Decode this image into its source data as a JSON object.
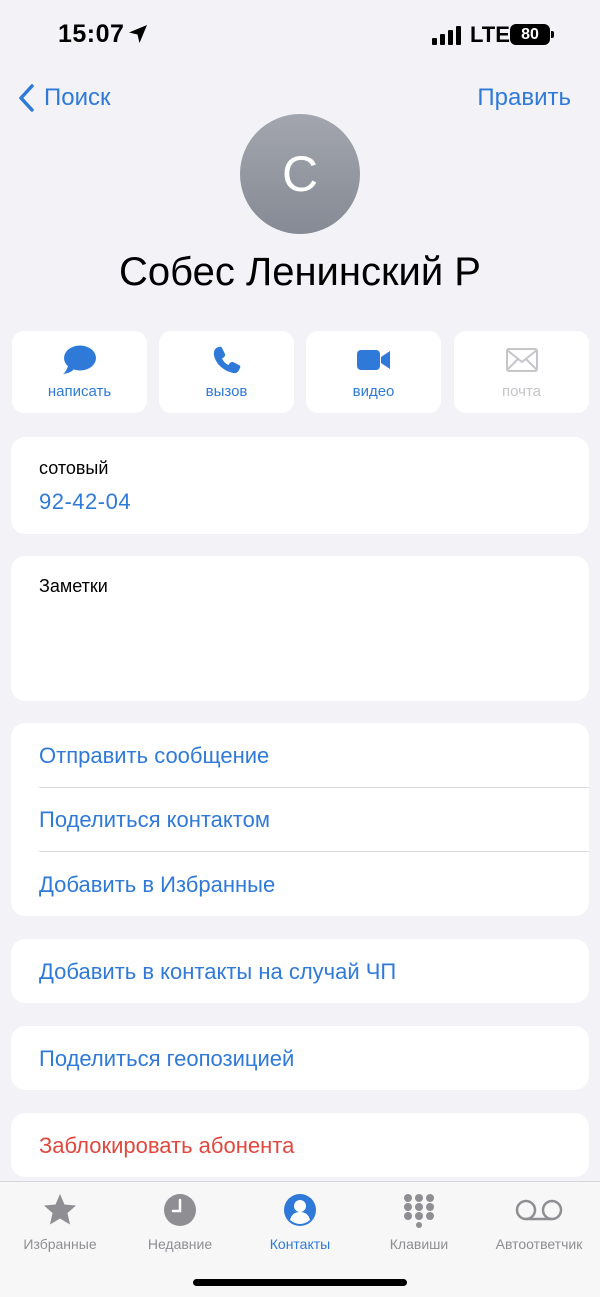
{
  "status": {
    "time": "15:07",
    "network": "LTE",
    "battery": "80"
  },
  "nav": {
    "back_label": "Поиск",
    "edit_label": "Править"
  },
  "contact": {
    "initial": "С",
    "name": "Собес Ленинский Р"
  },
  "actions": [
    {
      "label": "написать",
      "icon": "message-icon",
      "enabled": true
    },
    {
      "label": "вызов",
      "icon": "phone-icon",
      "enabled": true
    },
    {
      "label": "видео",
      "icon": "video-icon",
      "enabled": true
    },
    {
      "label": "почта",
      "icon": "mail-icon",
      "enabled": false
    }
  ],
  "phone": {
    "label": "сотовый",
    "value": "92-42-04"
  },
  "notes": {
    "label": "Заметки"
  },
  "links": {
    "send_message": "Отправить сообщение",
    "share_contact": "Поделиться контактом",
    "add_favorites": "Добавить в Избранные",
    "add_emergency": "Добавить в контакты на случай ЧП",
    "share_location": "Поделиться геопозицией",
    "block_caller": "Заблокировать абонента"
  },
  "tabs": [
    {
      "label": "Избранные",
      "icon": "star-icon",
      "active": false
    },
    {
      "label": "Недавние",
      "icon": "clock-icon",
      "active": false
    },
    {
      "label": "Контакты",
      "icon": "contact-icon",
      "active": true
    },
    {
      "label": "Клавиши",
      "icon": "keypad-icon",
      "active": false
    },
    {
      "label": "Автоответчик",
      "icon": "voicemail-icon",
      "active": false
    }
  ],
  "colors": {
    "accent": "#2f7ad9",
    "destructive": "#e0483e",
    "background": "#f2f2f7",
    "inactive": "#8e8e93"
  }
}
